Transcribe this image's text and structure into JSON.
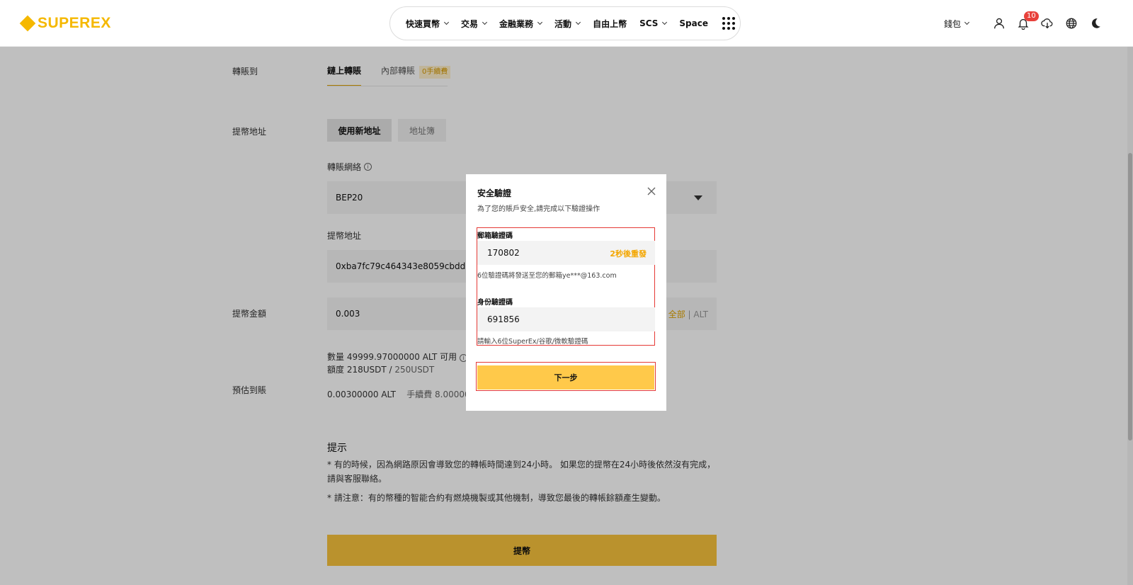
{
  "header": {
    "brand": "SUPEREX",
    "nav": [
      {
        "label": "快速買幣",
        "has_dropdown": true
      },
      {
        "label": "交易",
        "has_dropdown": true
      },
      {
        "label": "金融業務",
        "has_dropdown": true
      },
      {
        "label": "活動",
        "has_dropdown": true
      },
      {
        "label": "自由上幣",
        "has_dropdown": false
      },
      {
        "label": "SCS",
        "has_dropdown": true
      },
      {
        "label": "Space",
        "has_dropdown": false
      }
    ],
    "wallet_label": "錢包",
    "notification_count": "10",
    "icons": [
      "user-icon",
      "bell-icon",
      "download-icon",
      "globe-icon",
      "moon-icon",
      "apps-grid-icon"
    ]
  },
  "form": {
    "transfer_to_label": "轉賬到",
    "tabs": [
      {
        "label": "鏈上轉賬",
        "active": true
      },
      {
        "label": "內部轉賬",
        "active": false,
        "badge": "0手續費"
      }
    ],
    "address_label": "提幣地址",
    "address_buttons": [
      {
        "label": "使用新地址",
        "active": true
      },
      {
        "label": "地址簿",
        "active": false
      }
    ],
    "network_label": "轉賬網絡",
    "network_value": "BEP20",
    "address_field_label": "提幣地址",
    "address_value": "0xba7fc79c464343e8059cbdd3950",
    "amount_label": "提幣金額",
    "amount_value": "0.003",
    "amount_all": "全部",
    "amount_sep": "|",
    "amount_currency": "ALT",
    "available_text": "數量 49999.97000000 ALT 可用",
    "quota_text": "額度 218USDT / ",
    "quota_total": "250USDT",
    "estimate_label": "預估到賬",
    "estimate_value": "0.00300000 ALT",
    "fee_text": "手續費 8.0000000"
  },
  "hints": {
    "title": "提示",
    "line1": "* 有的時候，因為網路原因會導致您的轉帳時間達到24小時。 如果您的提幣在24小時後依然沒有完成，請與客服聯絡。",
    "line2": "* 請注意：有的幣種的智能合約有燃燒機製或其他機制，導致您最後的轉帳餘額產生變動。"
  },
  "submit_label": "提幣",
  "modal": {
    "title": "安全驗證",
    "subtitle": "為了您的賬戶安全,請完成以下驗證操作",
    "email_label": "郵箱驗證碼",
    "email_value": "170802",
    "resend": "2秒後重發",
    "email_help": "6位驗證碼將發送至您的郵箱ye***@163.com",
    "auth_label": "身份驗證碼",
    "auth_value": "691856",
    "auth_help": "請輸入6位SuperEx/谷歌/微軟驗證碼",
    "next_label": "下一步",
    "highlight_color": "#e53935"
  },
  "colors": {
    "brand": "#f5b800",
    "primary_button": "#f9c33c",
    "accent_text": "#e0a300"
  }
}
